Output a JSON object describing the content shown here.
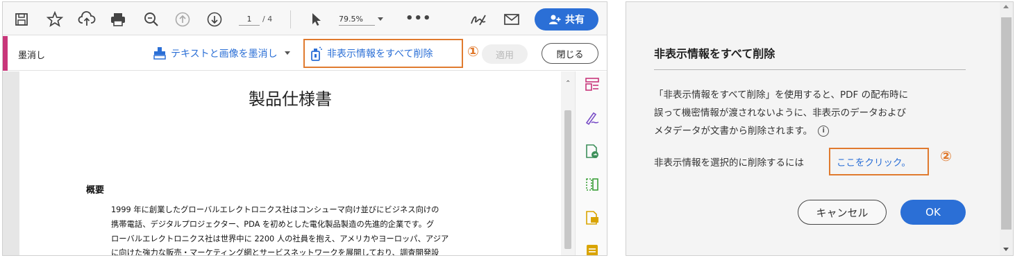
{
  "toolbar": {
    "icons": [
      "save-icon",
      "bookmark-star-icon",
      "upload-cloud-icon",
      "print-icon",
      "zoom-search-icon",
      "page-up-icon",
      "page-down-icon",
      "select-cursor-icon",
      "more-icon",
      "sign-icon",
      "mail-icon",
      "add-user-icon"
    ],
    "page_current": "1",
    "page_total": "/ 4",
    "zoom": "79.5%",
    "more": "•••",
    "share_label": "共有"
  },
  "redact_bar": {
    "tool_name": "墨消し",
    "redact_text_images": "テキストと画像を墨消し",
    "remove_hidden": "非表示情報をすべて削除",
    "step1": "①",
    "apply": "適用",
    "close": "閉じる"
  },
  "document": {
    "title": "製品仕様書",
    "heading": "概要",
    "lines": [
      "1999 年に創業したグローバルエレクトロニクス社はコンシューマ向け並びにビジネス向けの",
      "携帯電話、デジタルプロジェクター、PDA を初めとした電化製品製造の先進的企業です。グ",
      "ローバルエレクトロニクス社は世界中に 2200 人の社員を抱え、アメリカやヨーロッパ、アジア",
      "に向けた強力な販売・マーケティング網とサービスネットワークを展開しており、調査開発設"
    ]
  },
  "right_rail": {
    "icons": [
      "organize-pages-icon",
      "fill-sign-icon",
      "export-pdf-icon",
      "compare-icon",
      "comment-icon",
      "note-icon"
    ]
  },
  "dialog": {
    "title": "非表示情報をすべて削除",
    "body_lines": [
      "「非表示情報をすべて削除」を使用すると、PDF の配布時に",
      "誤って機密情報が渡されないように、非表示のデータおよび",
      "メタデータが文書から削除されます。"
    ],
    "info": "i",
    "link_prefix": "非表示情報を選択的に削除するには",
    "link_text": "ここをクリック。",
    "step2": "②",
    "cancel": "キャンセル",
    "ok": "OK"
  },
  "colors": {
    "accent_blue": "#2b6fd6",
    "highlight_orange": "#e07a2e",
    "redact_magenta": "#c8367a"
  }
}
